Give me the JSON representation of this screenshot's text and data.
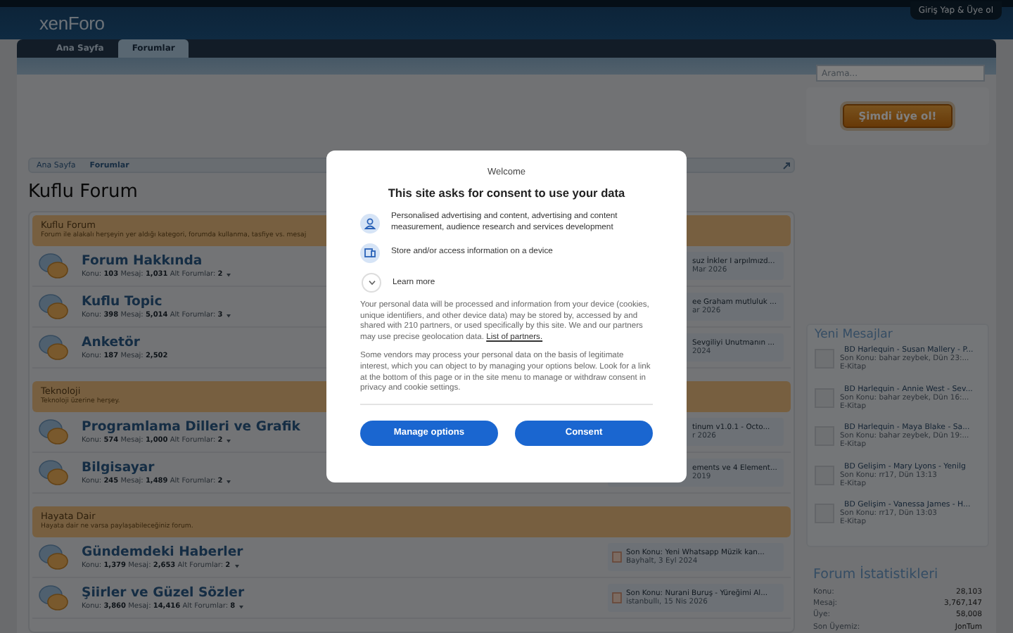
{
  "header": {
    "logo": "xenForo",
    "login_link": "Giriş Yap & Üye ol",
    "tabs": [
      {
        "label": "Ana Sayfa",
        "selected": false
      },
      {
        "label": "Forumlar",
        "selected": true
      }
    ],
    "search": {
      "placeholder": "Arama..."
    }
  },
  "signup_button": "Şimdi üye ol!",
  "breadcrumb": [
    "Ana Sayfa",
    "Forumlar"
  ],
  "page_title": "Kuflu Forum",
  "categories": [
    {
      "title": "Kuflu Forum",
      "description": "Forum ile alakalı herşeyin yer aldığı kategori, forumda kullanma, tasfiye vs. mesaj",
      "forums": [
        {
          "title": "Forum Hakkında",
          "stats": "Konu: **103** Mesaj: **1,031** Alt Forumlar: **2**",
          "has_subforums": true,
          "last_post": {
            "kind": "covered",
            "line_1": "suz İnkler I arpılmızd...",
            "line_2": "Mar 2026"
          }
        },
        {
          "title": "Kuflu Topic",
          "stats": "Konu: **398** Mesaj: **5,014** Alt Forumlar: **3**",
          "has_subforums": true,
          "last_post": {
            "kind": "covered",
            "line_1": "ee Graham mutluluk ...",
            "line_2": "ar 2026"
          }
        },
        {
          "title": "Anketör",
          "stats": "Konu: **187** Mesaj: **2,502**",
          "has_subforums": false,
          "last_post": {
            "kind": "covered",
            "line_1": "Sevgiliyi Unutmanın ...",
            "line_2": "2024"
          }
        }
      ]
    },
    {
      "title": "Teknoloji",
      "description": "Teknoloji üzerine herşey.",
      "forums": [
        {
          "title": "Programlama Dilleri ve Grafik",
          "stats": "Konu: **574** Mesaj: **1,000** Alt Forumlar: **2**",
          "has_subforums": true,
          "last_post": {
            "kind": "covered",
            "line_1": "tinum v1.0.1 - Octo...",
            "line_2": "r 2026"
          }
        },
        {
          "title": "Bilgisayar",
          "stats": "Konu: **245** Mesaj: **1,489** Alt Forumlar: **2**",
          "has_subforums": true,
          "last_post": {
            "kind": "covered",
            "line_1": "ements ve 4 Element...",
            "line_2": "2019"
          }
        }
      ]
    },
    {
      "title": "Hayata Dair",
      "description": "Hayata dair ne varsa paylaşabileceğiniz forum.",
      "forums": [
        {
          "title": "Gündemdeki Haberler",
          "stats": "Konu: **1,379** Mesaj: **2,653** Alt Forumlar: **2**",
          "has_subforums": true,
          "last_post": {
            "kind": "full",
            "line_1": "Son Konu: Yeni Whatsapp Müzik kan...",
            "line_2": "Bayhalt, 3 Eyl 2024"
          }
        },
        {
          "title": "Şiirler ve Güzel Sözler",
          "stats": "Konu: **3,860** Mesaj: **14,416** Alt Forumlar: **8**",
          "has_subforums": true,
          "last_post": {
            "kind": "full",
            "line_1": "Son Konu: Nurani Buruş - Yüreğimi Al...",
            "line_2": "istanbullı, 15 Nis 2026"
          }
        }
      ]
    }
  ],
  "new_posts": {
    "title": "Yeni Mesajlar",
    "items": [
      {
        "title": "BD Harlequin - Susan Mallery - P...",
        "last": "Son Konu: bahar zeybek, Dün 23:...",
        "forum": "E-Kitap"
      },
      {
        "title": "BD Harlequin - Annie West - Sev...",
        "last": "Son Konu: bahar zeybek, Dün 16:...",
        "forum": "E-Kitap"
      },
      {
        "title": "BD Harlequin - Maya Blake - Sa...",
        "last": "Son Konu: bahar zeybek, Dün 19:...",
        "forum": "E-Kitap"
      },
      {
        "title": "BD Gelişim - Mary Lyons - Yenilg",
        "last": "Son Konu: rr17, Dün 13:13",
        "forum": "E-Kitap"
      },
      {
        "title": "BD Gelişim - Vanessa James - H...",
        "last": "Son Konu: rr17, Dün 13:03",
        "forum": "E-Kitap"
      }
    ]
  },
  "stats": {
    "title": "Forum İstatistikleri",
    "rows": [
      {
        "label": "Konu:",
        "value": "28,103"
      },
      {
        "label": "Mesaj:",
        "value": "3,767,147"
      },
      {
        "label": "Üye:",
        "value": "58,008"
      },
      {
        "label": "Son Üyemiz:",
        "value": "JonTum"
      }
    ]
  },
  "consent": {
    "welcome": "Welcome",
    "title": "This site asks for consent to use your data",
    "purposes": [
      {
        "kind": "person",
        "text": "Personalised advertising and content, advertising and content measurement, audience research and services development"
      },
      {
        "kind": "device",
        "text": "Store and/or access information on a device"
      }
    ],
    "learn_more": "Learn more",
    "paragraphs": [
      "Your personal data will be processed and information from your device (cookies, unique identifiers, and other device data) may be stored by, accessed by and shared with 210 partners, or used specifically by this site. We and our partners may use precise geolocation data.",
      "Some vendors may process your personal data on the basis of legitimate interest, which you can object to by managing your options below. Look for a link at the bottom of this page or in the site menu to manage or withdraw consent in privacy and cookie settings."
    ],
    "partners_link": "List of partners.",
    "buttons": [
      "Manage options",
      "Consent"
    ]
  }
}
